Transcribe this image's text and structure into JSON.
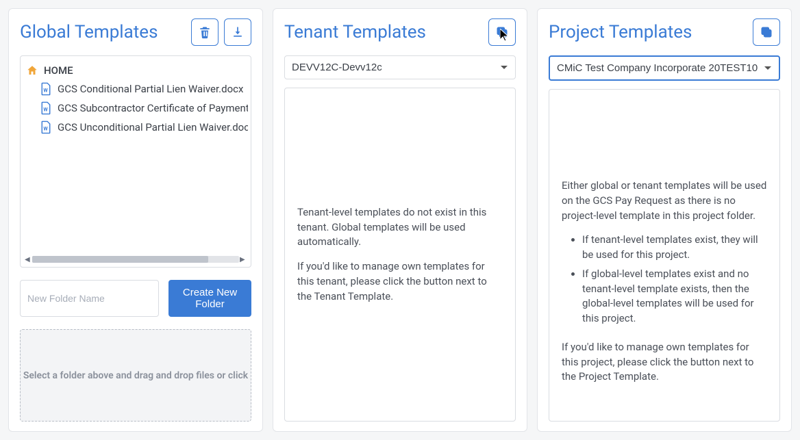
{
  "global": {
    "title": "Global Templates",
    "home_label": "HOME",
    "files": [
      "GCS Conditional Partial Lien Waiver.docx",
      "GCS Subcontractor Certificate of Payment.docx",
      "GCS Unconditional Partial Lien Waiver.docx"
    ],
    "new_folder_placeholder": "New Folder Name",
    "create_folder_label": "Create New Folder",
    "dropzone_text": "Select a folder above and drag and drop files or click"
  },
  "tenant": {
    "title": "Tenant Templates",
    "selected": "DEVV12C-Devv12c",
    "p1": "Tenant-level templates do not exist in this tenant. Global templates will be used automatically.",
    "p2": "If you'd like to manage own templates for this tenant, please click the button next to the Tenant Template."
  },
  "project": {
    "title": "Project Templates",
    "selected": "CMiC Test Company Incorporate 20TEST10",
    "p1": "Either global or tenant templates will be used on the GCS Pay Request as there is no project-level template in this project folder.",
    "b1": "If tenant-level templates exist, they will be used for this project.",
    "b2": "If global-level templates exist and no tenant-level template exists, then the global-level templates will be used for this project.",
    "p2": "If you'd like to manage own templates for this project, please click the button next to the Project Template."
  }
}
